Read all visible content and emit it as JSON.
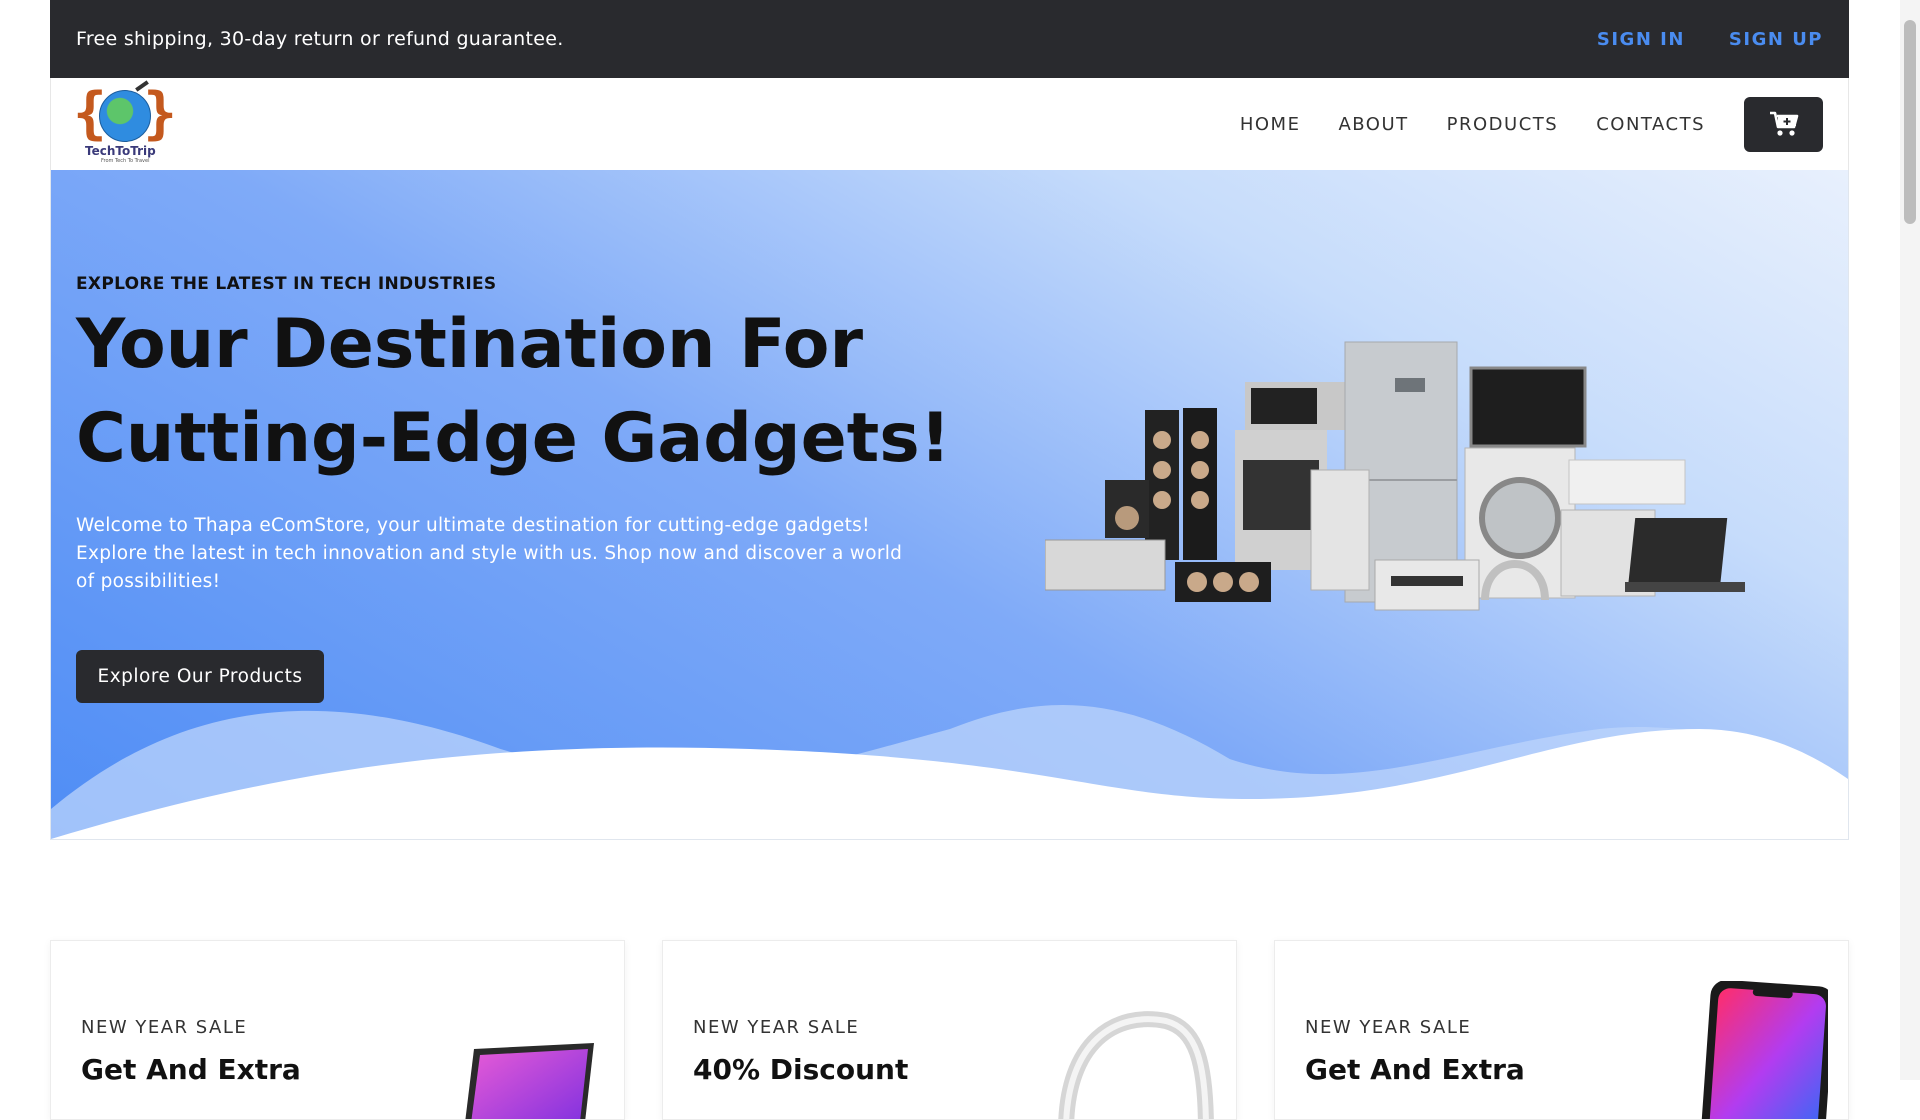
{
  "topbar": {
    "promo": "Free shipping, 30-day return or refund guarantee.",
    "sign_in": "SIGN IN",
    "sign_up": "SIGN UP"
  },
  "logo": {
    "name": "TechToTrip",
    "tagline": "From Tech To Travel"
  },
  "nav": {
    "items": [
      "HOME",
      "ABOUT",
      "PRODUCTS",
      "CONTACTS"
    ],
    "cart_icon": "cart-icon"
  },
  "hero": {
    "eyebrow": "EXPLORE THE LATEST IN TECH INDUSTRIES",
    "title_line1": "Your Destination For",
    "title_line2": "Cutting-Edge Gadgets!",
    "description": "Welcome to Thapa eComStore, your ultimate destination for cutting-edge gadgets! Explore the latest in tech innovation and style with us. Shop now and discover a world of possibilities!",
    "cta": "Explore Our Products"
  },
  "cards": [
    {
      "label": "NEW YEAR SALE",
      "title": "Get And Extra",
      "image": "laptop-image"
    },
    {
      "label": "NEW YEAR SALE",
      "title": "40% Discount",
      "image": "headphones-image"
    },
    {
      "label": "NEW YEAR SALE",
      "title": "Get And Extra",
      "image": "smartphone-image"
    }
  ],
  "colors": {
    "dark": "#292a2e",
    "accent_link": "#4a8cf0",
    "hero_gradient_start": "#4f8df5",
    "hero_gradient_end": "#e8f0fd"
  }
}
